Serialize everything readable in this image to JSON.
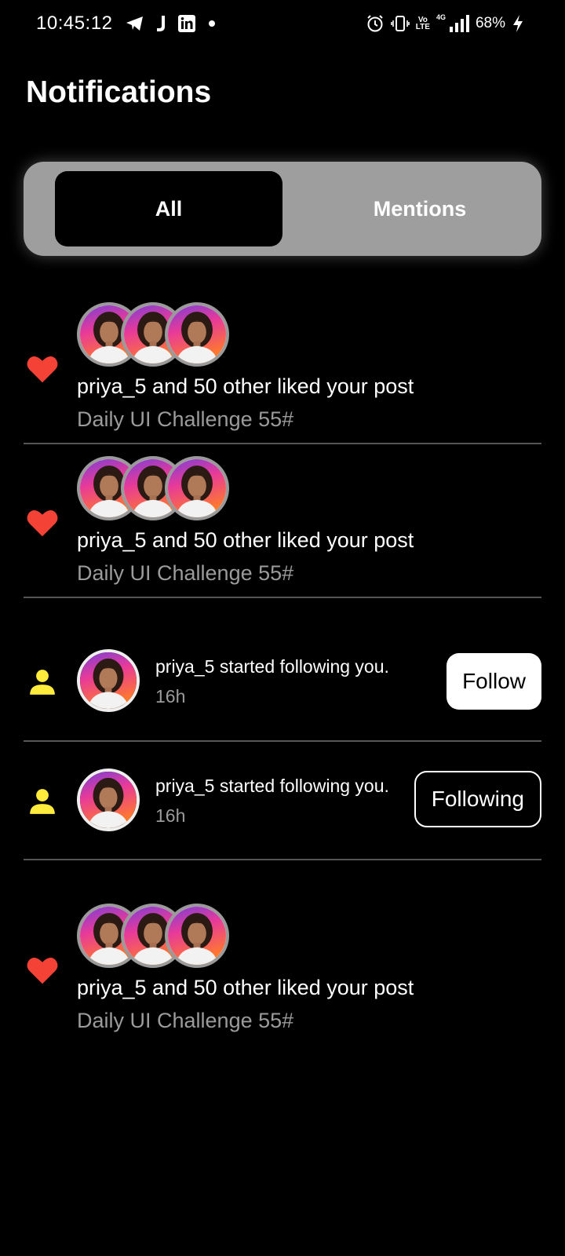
{
  "status_bar": {
    "time": "10:45:12",
    "battery": "68%",
    "network": "4G",
    "volte": "Vo LTE",
    "left_icons": [
      "telegram-icon",
      "j-app-icon",
      "linkedin-icon",
      "dot-icon"
    ],
    "right_icons": [
      "alarm-icon",
      "vibrate-icon",
      "volte-icon",
      "signal-icon",
      "charging-icon"
    ]
  },
  "header": {
    "title": "Notifications"
  },
  "tabs": [
    {
      "label": "All",
      "selected": true
    },
    {
      "label": "Mentions",
      "selected": false
    }
  ],
  "colors": {
    "background": "#000000",
    "tab_bar": "#9e9e9e",
    "like_heart": "#f44336",
    "follow_icon": "#ffeb3b",
    "secondary_text": "#9b9b9b",
    "divider": "#555555"
  },
  "notifications": [
    {
      "type": "like",
      "icon": "heart-icon",
      "text": "priya_5 and 50 other liked your post",
      "subtext": "Daily UI Challenge 55#"
    },
    {
      "type": "like",
      "icon": "heart-icon",
      "text": "priya_5 and 50 other liked your post",
      "subtext": "Daily UI Challenge 55#"
    },
    {
      "type": "follow",
      "icon": "person-icon",
      "text": "priya_5 started following you.",
      "time": "16h",
      "button": "Follow"
    },
    {
      "type": "follow",
      "icon": "person-icon",
      "text": "priya_5 started following you.",
      "time": "16h",
      "button": "Following"
    },
    {
      "type": "like",
      "icon": "heart-icon",
      "text": "priya_5 and 50 other liked your post",
      "subtext": "Daily UI Challenge 55#"
    }
  ]
}
